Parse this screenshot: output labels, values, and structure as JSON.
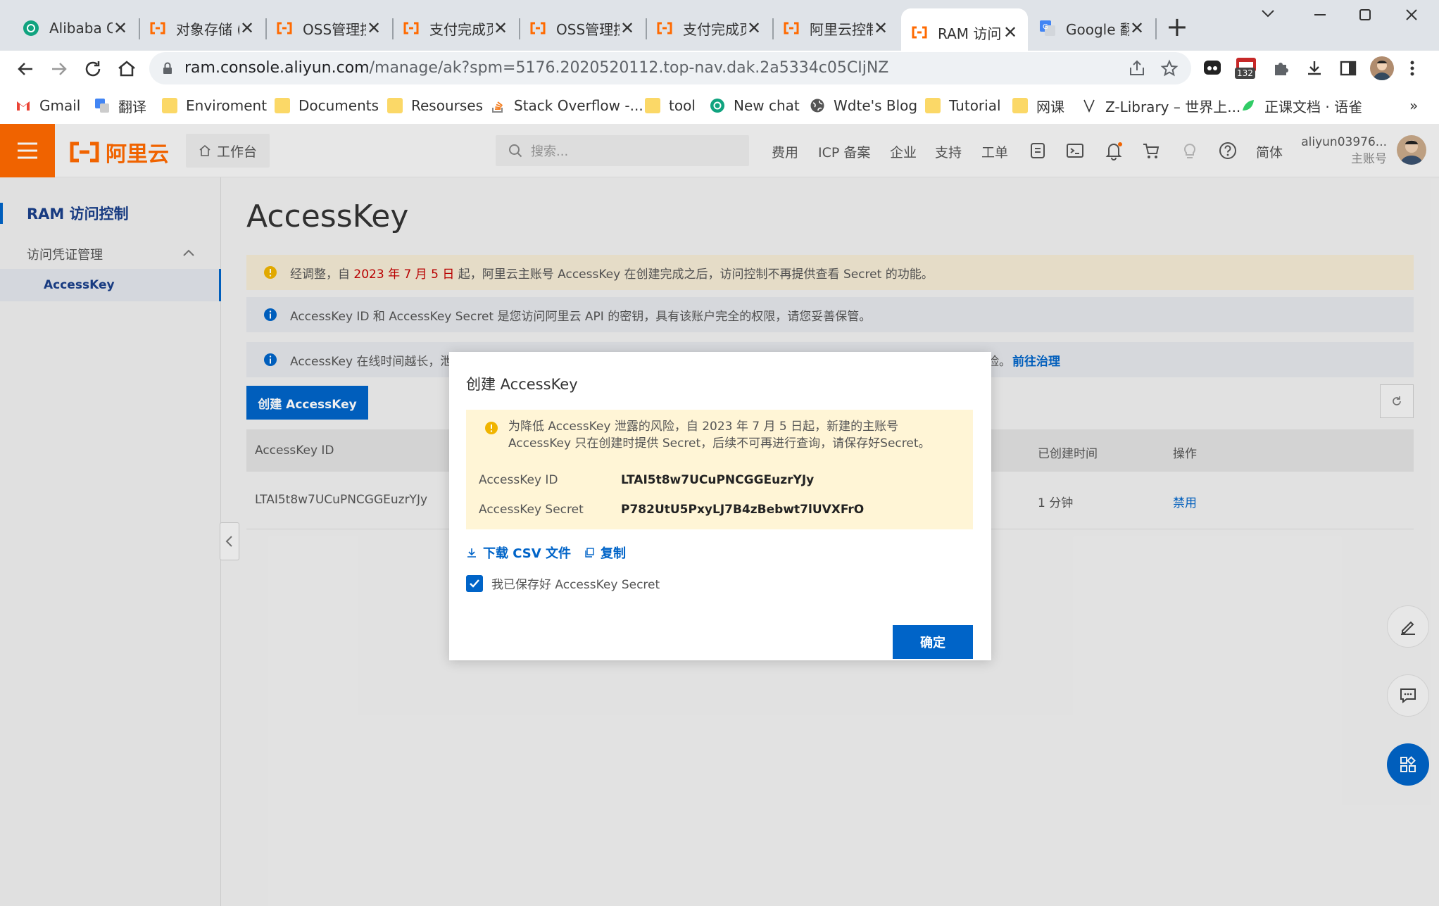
{
  "browser": {
    "tabs": [
      {
        "title": "Alibaba O",
        "icon": "chatgpt-icon"
      },
      {
        "title": "对象存储 (",
        "icon": "aliyun-icon"
      },
      {
        "title": "OSS管理控",
        "icon": "aliyun-icon"
      },
      {
        "title": "支付完成页",
        "icon": "aliyun-icon"
      },
      {
        "title": "OSS管理控",
        "icon": "aliyun-icon"
      },
      {
        "title": "支付完成页",
        "icon": "aliyun-icon"
      },
      {
        "title": "阿里云控制",
        "icon": "aliyun-icon"
      },
      {
        "title": "RAM 访问",
        "icon": "aliyun-icon",
        "active": true
      },
      {
        "title": "Google 翻",
        "icon": "google-translate-icon"
      }
    ],
    "url_host": "ram.console.aliyun.com",
    "url_rest": "/manage/ak?spm=5176.2020520112.top-nav.dak.2a5334c05CIjNZ",
    "extension_badge": "132",
    "bookmarks": [
      "Gmail",
      "翻译",
      "Enviroment",
      "Documents",
      "Resourses",
      "Stack Overflow -...",
      "tool",
      "New chat",
      "Wdte's Blog",
      "Tutorial",
      "网课",
      "Z-Library – 世界上...",
      "正课文档 · 语雀"
    ],
    "bookmarks_more": "»"
  },
  "topnav": {
    "logo": "阿里云",
    "workbench": "工作台",
    "search_placeholder": "搜索...",
    "links": [
      "费用",
      "ICP 备案",
      "企业",
      "支持",
      "工单"
    ],
    "language": "简体",
    "account_name": "aliyun03976...",
    "account_type": "主账号"
  },
  "sidebar": {
    "title": "RAM 访问控制",
    "group": "访问凭证管理",
    "item": "AccessKey"
  },
  "main": {
    "title": "AccessKey",
    "alert1_pre": "经调整，自 ",
    "alert1_date": "2023 年 7 月 5 日",
    "alert1_post": " 起，阿里云主账号 AccessKey 在创建完成之后，访问控制不再提供查看 Secret 的功能。",
    "alert2": "AccessKey ID 和 AccessKey Secret 是您访问阿里云 API 的密钥，具有该账户完全的权限，请您妥善保管。",
    "alert3_pre": "AccessKey 在线时间越长，泄",
    "alert3_mid": "险。",
    "alert3_link": "前往治理",
    "create_button": "创建 AccessKey",
    "table": {
      "headers": [
        "AccessKey ID",
        "已创建时间",
        "操作"
      ],
      "row": {
        "id": "LTAI5t8w7UCuPNCGGEuzrYJy",
        "created": "1 分钟",
        "action": "禁用"
      }
    }
  },
  "modal": {
    "title": "创建 AccessKey",
    "warning_line1": "为降低 AccessKey 泄露的风险，自 2023 年 7 月 5 日起，新建的主账号",
    "warning_line2": "AccessKey 只在创建时提供 Secret，后续不可再进行查询，请保存好Secret。",
    "id_label": "AccessKey ID",
    "id_value": "LTAI5t8w7UCuPNCGGEuzrYJy",
    "secret_label": "AccessKey Secret",
    "secret_value": "P782UtU5PxyLJ7B4zBebwt7lUVXFrO",
    "download_csv": "下载 CSV 文件",
    "copy": "复制",
    "checkbox_label": "我已保存好 AccessKey Secret",
    "checkbox_checked": true,
    "ok_button": "确定"
  },
  "colors": {
    "brand": "#ff6a00",
    "primary": "#0064c8",
    "warning_bg": "#fff5d6",
    "date_red": "#c40000"
  }
}
